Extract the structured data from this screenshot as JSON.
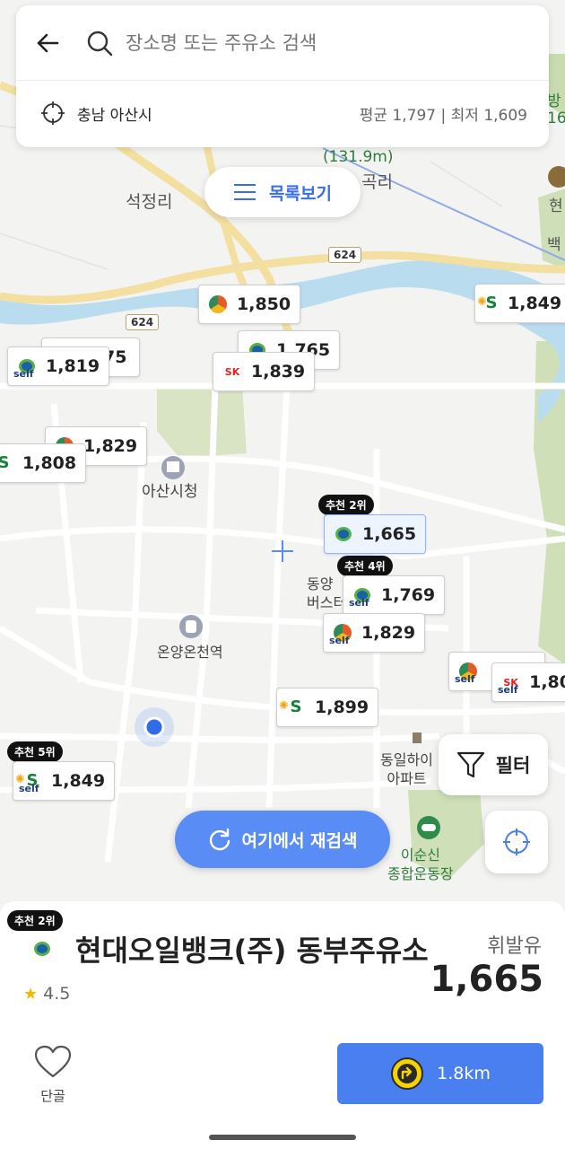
{
  "search": {
    "placeholder": "장소명 또는 주유소 검색",
    "region": "충남 아산시",
    "price_summary": "평균 1,797 | 최저 1,609"
  },
  "list_button": {
    "label": "목록보기"
  },
  "filter_button": {
    "label": "필터"
  },
  "research_button": {
    "label": "여기에서 재검색"
  },
  "map": {
    "labels": {
      "seokjeong": "석정리",
      "elevation": "(131.9m)",
      "gokri": "곡리",
      "asan_city_hall": "아산시청",
      "onyang_station": "온양온천역",
      "bus_terminal": "동양\n버스터",
      "apartment": "동일하이\n아파트",
      "sports_complex": "이순신\n종합운동장",
      "right_top_a": "방",
      "right_top_b": "16",
      "right_mid_a": "현",
      "right_mid_b": "백"
    },
    "road_numbers": [
      "624",
      "624"
    ],
    "markers": [
      {
        "brand": "gs",
        "self": false,
        "price": "1,850"
      },
      {
        "brand": "s",
        "self": false,
        "price": "1,849"
      },
      {
        "brand": "hyundai",
        "self": true,
        "price": "1,819"
      },
      {
        "brand": "hyundai",
        "self": false,
        "price": "1,765"
      },
      {
        "brand": "sk",
        "self": false,
        "price": "1,839"
      },
      {
        "brand": "gs",
        "self": false,
        "price": "1,829"
      },
      {
        "brand": "s",
        "self": false,
        "price": "1,808"
      },
      {
        "brand": "hyundai",
        "self": false,
        "price": "1,665",
        "rank": "추천 2위"
      },
      {
        "brand": "hyundai",
        "self": true,
        "price": "1,769",
        "rank": "추천 4위"
      },
      {
        "brand": "gs",
        "self": true,
        "price": "1,829"
      },
      {
        "brand": "gs",
        "self": true,
        "price": ""
      },
      {
        "brand": "sk",
        "self": true,
        "price": "1,80"
      },
      {
        "brand": "s",
        "self": false,
        "price": "1,899"
      },
      {
        "brand": "s",
        "self": true,
        "price": "1,849",
        "rank": "추천 5위"
      }
    ],
    "partial_price": "75"
  },
  "sheet": {
    "rank": "추천 2위",
    "station_name": "현대오일뱅크(주) 동부주유소",
    "rating": "4.5",
    "fuel_type": "휘발유",
    "price": "1,665",
    "favorite_label": "단골",
    "distance": "1.8km"
  },
  "colors": {
    "accent": "#5a8cf5",
    "navigate": "#4a7ff0",
    "river": "#b9dcef",
    "park": "#c8dcb0"
  },
  "icons": [
    "back-arrow-icon",
    "search-icon",
    "crosshair-icon",
    "list-icon",
    "filter-icon",
    "refresh-icon",
    "locate-icon",
    "star-icon",
    "heart-icon",
    "navigate-icon"
  ]
}
